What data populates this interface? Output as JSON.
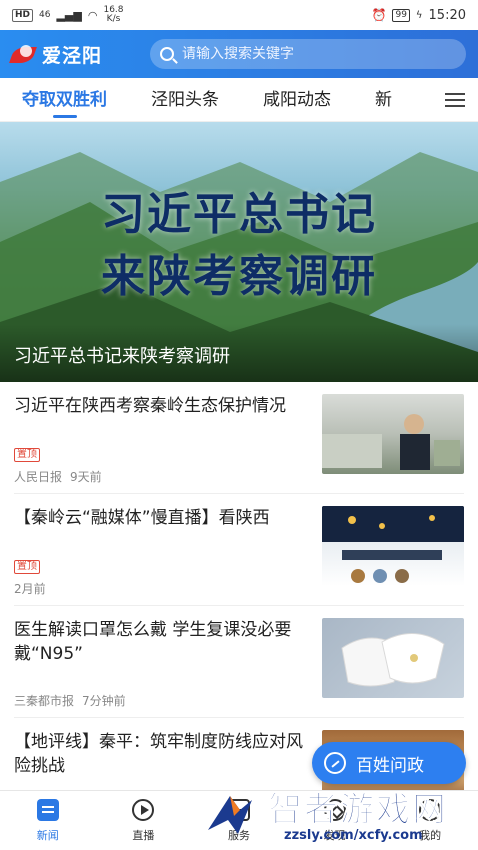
{
  "status_bar": {
    "network_badge": "HD",
    "signal": "46",
    "speed_value": "16.8",
    "speed_unit": "K/s",
    "battery": "99",
    "time": "15:20"
  },
  "header": {
    "logo_text": "爱泾阳",
    "search_placeholder": "请输入搜索关键字"
  },
  "tabs": [
    {
      "label": "夺取双胜利",
      "active": true
    },
    {
      "label": "泾阳头条",
      "active": false
    },
    {
      "label": "咸阳动态",
      "active": false
    },
    {
      "label": "新",
      "active": false
    }
  ],
  "banner": {
    "headline_line1": "习近平总书记",
    "headline_line2": "来陕考察调研",
    "caption": "习近平总书记来陕考察调研"
  },
  "news": [
    {
      "title": "习近平在陕西考察秦岭生态保护情况",
      "badge": "置顶",
      "source": "人民日报",
      "time": "9天前"
    },
    {
      "title": "【秦岭云“融媒体”慢直播】看陕西",
      "badge": "置顶",
      "source": "",
      "time": "2月前"
    },
    {
      "title": "医生解读口罩怎么戴 学生复课没必要戴“N95”",
      "badge": "",
      "source": "三秦都市报",
      "time": "7分钟前"
    },
    {
      "title": "【地评线】秦平：筑牢制度防线应对风险挑战",
      "badge": "",
      "source": "",
      "time": ""
    }
  ],
  "fab": {
    "label": "百姓问政"
  },
  "bottom_nav": [
    {
      "label": "新闻",
      "icon": "news-icon",
      "active": true
    },
    {
      "label": "直播",
      "icon": "live-icon",
      "active": false
    },
    {
      "label": "服务",
      "icon": "service-icon",
      "active": false
    },
    {
      "label": "发现",
      "icon": "discover-icon",
      "active": false
    },
    {
      "label": "我的",
      "icon": "profile-icon",
      "active": false
    }
  ],
  "watermark": {
    "text": "智者游戏网",
    "url": "zzsly.com/xcfy.com"
  },
  "colors": {
    "brand": "#2b78e4",
    "header_start": "#2a8df0",
    "badge": "#e0493a"
  }
}
